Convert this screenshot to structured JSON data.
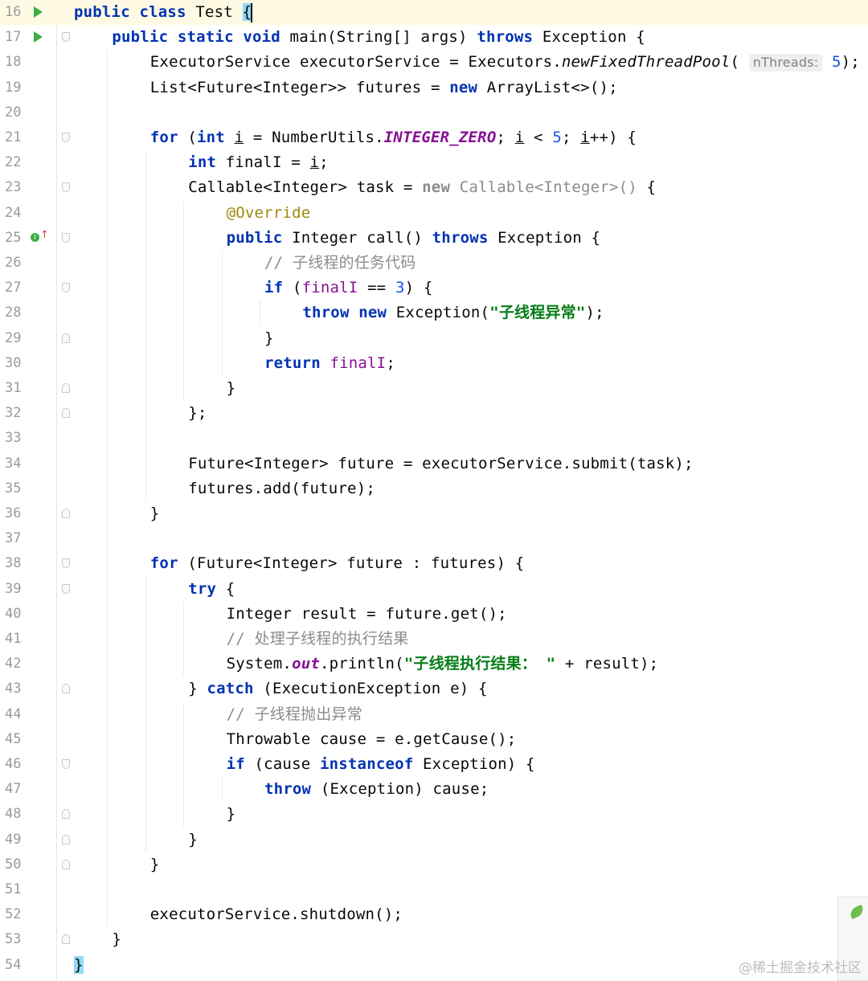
{
  "editor": {
    "lines": [
      {
        "n": "16",
        "run": true,
        "fold": "",
        "current": true,
        "indent": 0,
        "parts": [
          [
            "kw",
            "public"
          ],
          [
            "",
            "&nbsp;"
          ],
          [
            "kw",
            "class"
          ],
          [
            "",
            "&nbsp;Test&nbsp;"
          ],
          [
            "brace",
            "{"
          ],
          [
            "caret",
            ""
          ]
        ]
      },
      {
        "n": "17",
        "run": true,
        "fold": "open",
        "indent": 1,
        "parts": [
          [
            "kw",
            "public"
          ],
          [
            "",
            "&nbsp;"
          ],
          [
            "kw",
            "static"
          ],
          [
            "",
            "&nbsp;"
          ],
          [
            "kw",
            "void"
          ],
          [
            "",
            "&nbsp;main(String[]&nbsp;args)&nbsp;"
          ],
          [
            "kw",
            "throws"
          ],
          [
            "",
            "&nbsp;Exception&nbsp;{"
          ]
        ]
      },
      {
        "n": "18",
        "indent": 2,
        "parts": [
          [
            "",
            "ExecutorService&nbsp;executorService&nbsp;=&nbsp;Executors."
          ],
          [
            "italic",
            "newFixedThreadPool"
          ],
          [
            "",
            "(&nbsp;"
          ],
          [
            "hint",
            "nThreads:"
          ],
          [
            "",
            "&nbsp;"
          ],
          [
            "num",
            "5"
          ],
          [
            "",
            ");"
          ]
        ]
      },
      {
        "n": "19",
        "indent": 2,
        "parts": [
          [
            "",
            "List&lt;Future&lt;Integer&gt;&gt;&nbsp;futures&nbsp;=&nbsp;"
          ],
          [
            "kw",
            "new"
          ],
          [
            "",
            "&nbsp;ArrayList&lt;&gt;();"
          ]
        ]
      },
      {
        "n": "20",
        "indent": 0,
        "parts": []
      },
      {
        "n": "21",
        "fold": "open",
        "indent": 2,
        "parts": [
          [
            "kw",
            "for"
          ],
          [
            "",
            "&nbsp;("
          ],
          [
            "kw",
            "int"
          ],
          [
            "",
            "&nbsp;"
          ],
          [
            "ul",
            "i"
          ],
          [
            "",
            "&nbsp;=&nbsp;NumberUtils."
          ],
          [
            "constf",
            "INTEGER_ZERO"
          ],
          [
            "",
            ";&nbsp;"
          ],
          [
            "ul",
            "i"
          ],
          [
            "",
            "&nbsp;&lt;&nbsp;"
          ],
          [
            "num",
            "5"
          ],
          [
            "",
            ";&nbsp;"
          ],
          [
            "ul",
            "i"
          ],
          [
            "",
            "++)&nbsp;{"
          ]
        ]
      },
      {
        "n": "22",
        "indent": 3,
        "parts": [
          [
            "kw",
            "int"
          ],
          [
            "",
            "&nbsp;finalI&nbsp;=&nbsp;"
          ],
          [
            "ul",
            "i"
          ],
          [
            "",
            ";"
          ]
        ]
      },
      {
        "n": "23",
        "fold": "open",
        "indent": 3,
        "parts": [
          [
            "",
            "Callable&lt;Integer&gt;&nbsp;task&nbsp;=&nbsp;"
          ],
          [
            "kwdim",
            "new"
          ],
          [
            "dim",
            "&nbsp;Callable&lt;Integer&gt;()"
          ],
          [
            "",
            "&nbsp;{"
          ]
        ]
      },
      {
        "n": "24",
        "indent": 4,
        "parts": [
          [
            "ann",
            "@Override"
          ]
        ]
      },
      {
        "n": "25",
        "override": true,
        "fold": "open",
        "indent": 4,
        "parts": [
          [
            "kw",
            "public"
          ],
          [
            "",
            "&nbsp;Integer&nbsp;call()&nbsp;"
          ],
          [
            "kw",
            "throws"
          ],
          [
            "",
            "&nbsp;Exception&nbsp;{"
          ]
        ]
      },
      {
        "n": "26",
        "indent": 5,
        "parts": [
          [
            "cmt",
            "//&nbsp;子线程的任务代码"
          ]
        ]
      },
      {
        "n": "27",
        "fold": "open",
        "indent": 5,
        "parts": [
          [
            "kw",
            "if"
          ],
          [
            "",
            "&nbsp;("
          ],
          [
            "field",
            "finalI"
          ],
          [
            "",
            "&nbsp;==&nbsp;"
          ],
          [
            "num",
            "3"
          ],
          [
            "",
            ")&nbsp;{"
          ]
        ]
      },
      {
        "n": "28",
        "indent": 6,
        "parts": [
          [
            "kw",
            "throw"
          ],
          [
            "",
            "&nbsp;"
          ],
          [
            "kw",
            "new"
          ],
          [
            "",
            "&nbsp;Exception("
          ],
          [
            "str",
            "\"子线程异常\""
          ],
          [
            "",
            ");"
          ]
        ]
      },
      {
        "n": "29",
        "fold": "close",
        "indent": 5,
        "parts": [
          [
            "",
            "}"
          ]
        ]
      },
      {
        "n": "30",
        "indent": 5,
        "parts": [
          [
            "kw",
            "return"
          ],
          [
            "",
            "&nbsp;"
          ],
          [
            "field",
            "finalI"
          ],
          [
            "",
            ";"
          ]
        ]
      },
      {
        "n": "31",
        "fold": "close",
        "indent": 4,
        "parts": [
          [
            "",
            "}"
          ]
        ]
      },
      {
        "n": "32",
        "fold": "close",
        "indent": 3,
        "parts": [
          [
            "",
            "};"
          ]
        ]
      },
      {
        "n": "33",
        "indent": 0,
        "parts": []
      },
      {
        "n": "34",
        "indent": 3,
        "parts": [
          [
            "",
            "Future&lt;Integer&gt;&nbsp;future&nbsp;=&nbsp;executorService.submit(task);"
          ]
        ]
      },
      {
        "n": "35",
        "indent": 3,
        "parts": [
          [
            "",
            "futures.add(future);"
          ]
        ]
      },
      {
        "n": "36",
        "fold": "close",
        "indent": 2,
        "parts": [
          [
            "",
            "}"
          ]
        ]
      },
      {
        "n": "37",
        "indent": 0,
        "parts": []
      },
      {
        "n": "38",
        "fold": "open",
        "indent": 2,
        "parts": [
          [
            "kw",
            "for"
          ],
          [
            "",
            "&nbsp;(Future&lt;Integer&gt;&nbsp;future&nbsp;:&nbsp;futures)&nbsp;{"
          ]
        ]
      },
      {
        "n": "39",
        "fold": "open",
        "indent": 3,
        "parts": [
          [
            "kw",
            "try"
          ],
          [
            "",
            "&nbsp;{"
          ]
        ]
      },
      {
        "n": "40",
        "indent": 4,
        "parts": [
          [
            "",
            "Integer&nbsp;result&nbsp;=&nbsp;future.get();"
          ]
        ]
      },
      {
        "n": "41",
        "indent": 4,
        "parts": [
          [
            "cmt",
            "//&nbsp;处理子线程的执行结果"
          ]
        ]
      },
      {
        "n": "42",
        "indent": 4,
        "parts": [
          [
            "",
            "System."
          ],
          [
            "constf",
            "out"
          ],
          [
            "",
            ".println("
          ],
          [
            "str",
            "\"子线程执行结果：&nbsp;\""
          ],
          [
            "",
            "&nbsp;+&nbsp;result);"
          ]
        ]
      },
      {
        "n": "43",
        "fold": "close",
        "indent": 3,
        "parts": [
          [
            "",
            "}&nbsp;"
          ],
          [
            "kw",
            "catch"
          ],
          [
            "",
            "&nbsp;(ExecutionException&nbsp;e)&nbsp;{"
          ]
        ]
      },
      {
        "n": "44",
        "indent": 4,
        "parts": [
          [
            "cmt",
            "//&nbsp;子线程抛出异常"
          ]
        ]
      },
      {
        "n": "45",
        "indent": 4,
        "parts": [
          [
            "",
            "Throwable&nbsp;cause&nbsp;=&nbsp;e.getCause();"
          ]
        ]
      },
      {
        "n": "46",
        "fold": "open",
        "indent": 4,
        "parts": [
          [
            "kw",
            "if"
          ],
          [
            "",
            "&nbsp;(cause&nbsp;"
          ],
          [
            "kw",
            "instanceof"
          ],
          [
            "",
            "&nbsp;Exception)&nbsp;{"
          ]
        ]
      },
      {
        "n": "47",
        "indent": 5,
        "parts": [
          [
            "kw",
            "throw"
          ],
          [
            "",
            "&nbsp;(Exception)&nbsp;cause;"
          ]
        ]
      },
      {
        "n": "48",
        "fold": "close",
        "indent": 4,
        "parts": [
          [
            "",
            "}"
          ]
        ]
      },
      {
        "n": "49",
        "fold": "close",
        "indent": 3,
        "parts": [
          [
            "",
            "}"
          ]
        ]
      },
      {
        "n": "50",
        "fold": "close",
        "indent": 2,
        "parts": [
          [
            "",
            "}"
          ]
        ]
      },
      {
        "n": "51",
        "indent": 0,
        "parts": []
      },
      {
        "n": "52",
        "indent": 2,
        "parts": [
          [
            "",
            "executorService.shutdown();"
          ]
        ]
      },
      {
        "n": "53",
        "fold": "close",
        "indent": 1,
        "parts": [
          [
            "",
            "}"
          ]
        ]
      },
      {
        "n": "54",
        "indent": 0,
        "parts": [
          [
            "brace",
            "}"
          ]
        ]
      }
    ]
  },
  "override_marker": "I",
  "watermark": "@稀土掘金技术社区"
}
